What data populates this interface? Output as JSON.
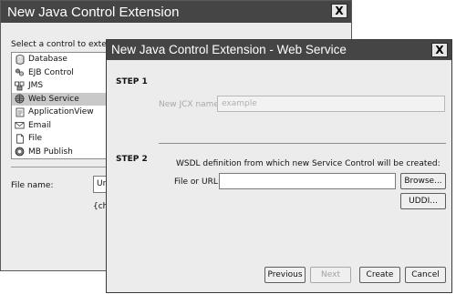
{
  "back_dialog": {
    "title": "New Java Control Extension",
    "close_glyph": "X",
    "select_label": "Select a control to extend:",
    "controls": [
      {
        "label": "Database",
        "icon": "database-icon",
        "selected": false
      },
      {
        "label": "EJB Control",
        "icon": "ejb-icon",
        "selected": false
      },
      {
        "label": "JMS",
        "icon": "jms-icon",
        "selected": false
      },
      {
        "label": "Web Service",
        "icon": "globe-icon",
        "selected": true
      },
      {
        "label": "ApplicationView",
        "icon": "document-icon",
        "selected": false
      },
      {
        "label": "Email",
        "icon": "envelope-icon",
        "selected": false
      },
      {
        "label": "File",
        "icon": "file-icon",
        "selected": false
      },
      {
        "label": "MB Publish",
        "icon": "mb-publish-icon",
        "selected": false
      }
    ],
    "filename_label": "File name:",
    "filename_value": "Ur",
    "curly_text": "{ch"
  },
  "front_dialog": {
    "title": "New Java Control Extension - Web Service",
    "close_glyph": "X",
    "step1_label": "STEP 1",
    "jck_label": "New JCX name:",
    "jck_placeholder": "example",
    "step2_label": "STEP 2",
    "wsdl_label": "WSDL definition from which new Service Control will be created:",
    "file_label": "File or URL:",
    "file_value": "",
    "browse_label": "Browse...",
    "uddi_label": "UDDI...",
    "previous_label": "Previous",
    "next_label": "Next",
    "create_label": "Create",
    "cancel_label": "Cancel"
  },
  "colors": {
    "titlebar": "#454545",
    "dialog_bg": "#ececec",
    "selection": "#c9c9c9",
    "disabled_text": "#a2a2a2"
  }
}
